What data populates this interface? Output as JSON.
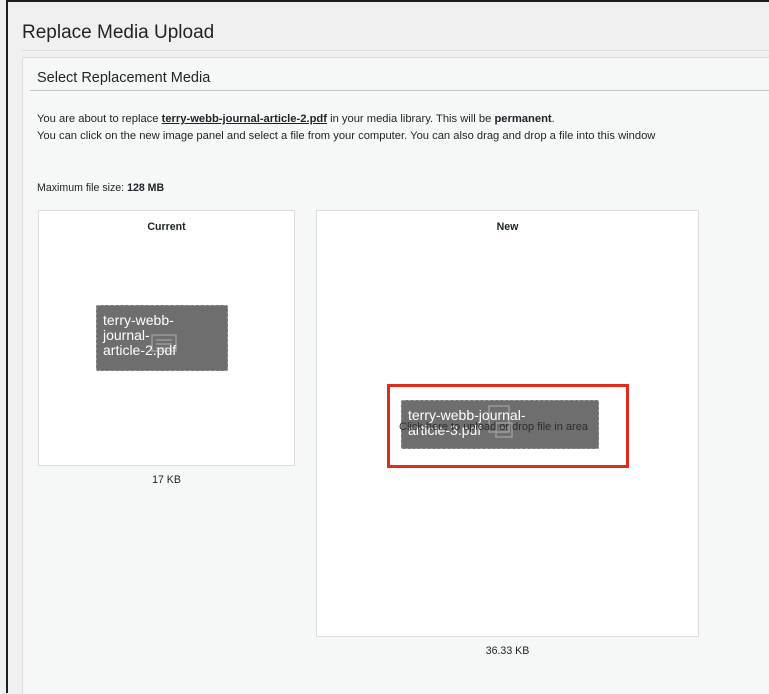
{
  "page": {
    "title": "Replace Media Upload"
  },
  "section": {
    "title": "Select Replacement Media"
  },
  "intro": {
    "line1_before": "You are about to replace ",
    "filename": "terry-webb-journal-article-2.pdf",
    "line1_middle": " in your media library. This will be ",
    "permanent": "permanent",
    "line1_end": ".",
    "line2": "You can click on the new image panel and select a file from your computer. You can also drag and drop a file into this window"
  },
  "max_size": {
    "label": "Maximum file size: ",
    "value": "128 MB"
  },
  "current": {
    "label": "Current",
    "file_name": "terry-webb-journal-article-2.pdf",
    "file_name_display": [
      "terry-webb-",
      "journal-",
      "article-2.pdf"
    ],
    "size": "17 KB",
    "icon": "document-icon"
  },
  "new": {
    "label": "New",
    "file_name_display": [
      "terry-webb-journal-",
      "article-3.pdf"
    ],
    "hint": "Click here to upload or drop file in area",
    "size": "36.33 KB",
    "icon": "document-icon"
  },
  "colors": {
    "highlight": "#e02c1b",
    "chip_background": "#6e6e6e",
    "panel_background": "#f6f7f7"
  }
}
